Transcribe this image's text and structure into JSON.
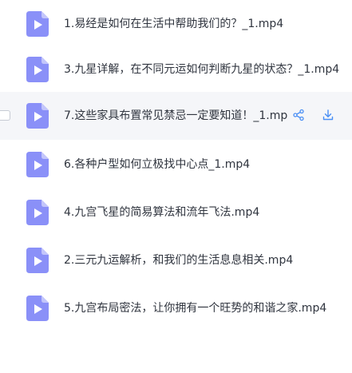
{
  "accent_color": "#4a8ff5",
  "file_icon_color": "#7f86f7",
  "files": [
    {
      "name": "1.易经是如何在生活中帮助我们的？_1.mp4",
      "icon": "video-file-icon"
    },
    {
      "name": "3.九星详解，在不同元运如何判断九星的状态？_1.mp4",
      "icon": "video-file-icon"
    },
    {
      "name": "7.这些家具布置常见禁忌一定要知道！_1.mp4",
      "icon": "video-file-icon",
      "hovered": true,
      "actions": [
        {
          "icon": "share-icon"
        },
        {
          "icon": "download-icon"
        }
      ]
    },
    {
      "name": "6.各种户型如何立极找中心点_1.mp4",
      "icon": "video-file-icon"
    },
    {
      "name": "4.九宫飞星的简易算法和流年飞法.mp4",
      "icon": "video-file-icon"
    },
    {
      "name": "2.三元九运解析，和我们的生活息息相关.mp4",
      "icon": "video-file-icon"
    },
    {
      "name": "5.九宫布局密法，让你拥有一个旺势的和谐之家.mp4",
      "icon": "video-file-icon"
    }
  ]
}
